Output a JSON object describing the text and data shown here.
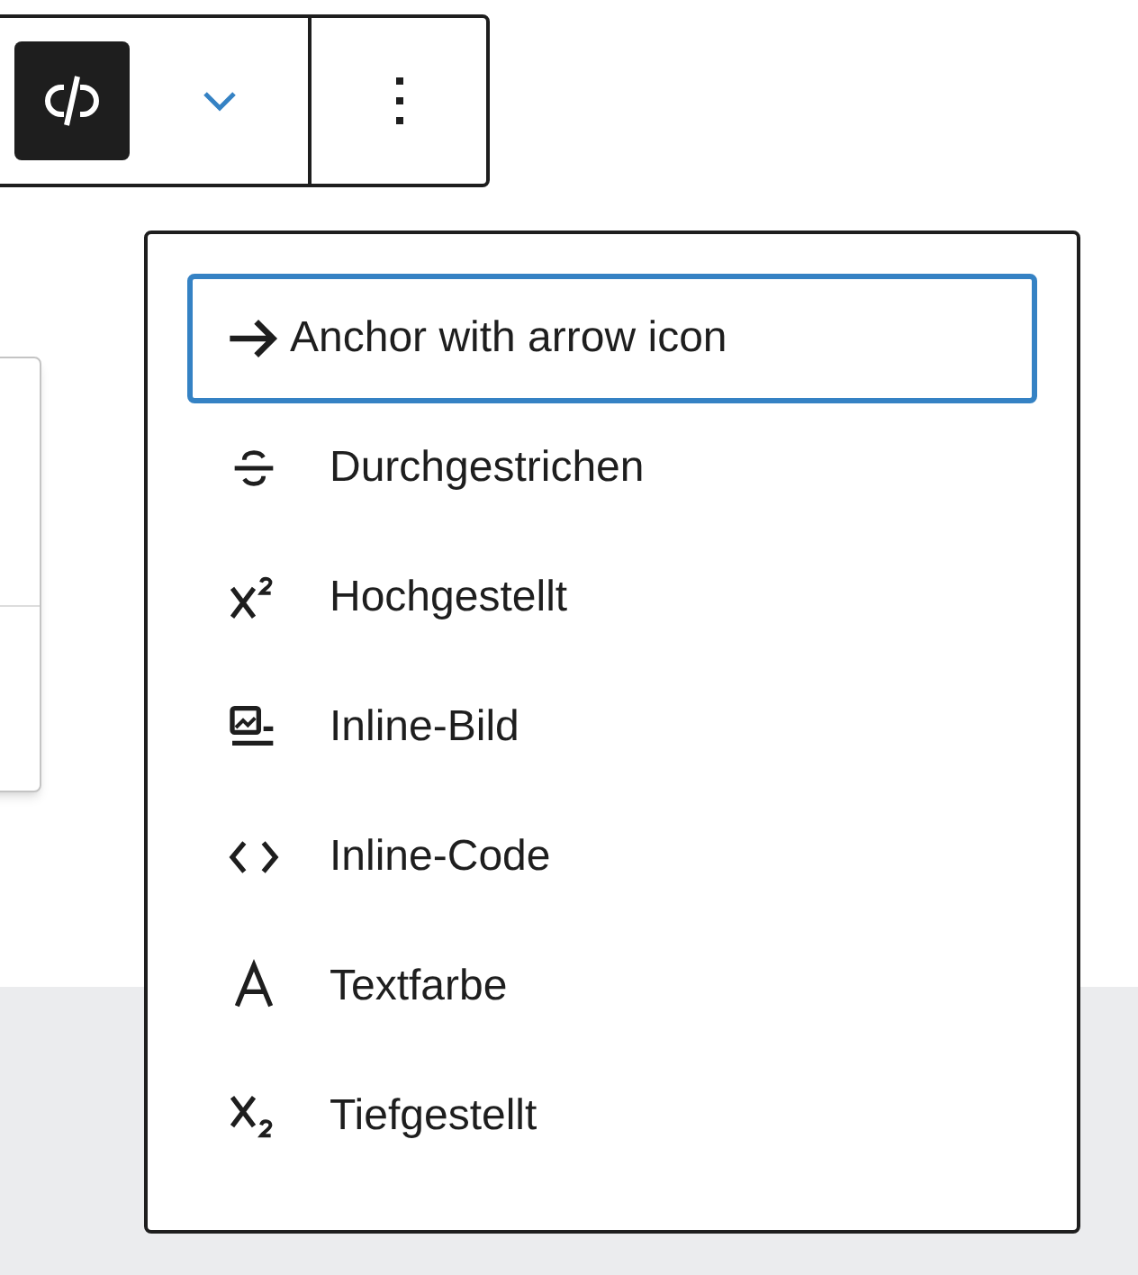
{
  "toolbar": {
    "unlink_pressed": true
  },
  "format_menu": {
    "items": [
      {
        "label": "Anchor with arrow icon",
        "selected": true
      },
      {
        "label": "Durchgestrichen",
        "selected": false
      },
      {
        "label": "Hochgestellt",
        "selected": false
      },
      {
        "label": "Inline-Bild",
        "selected": false
      },
      {
        "label": "Inline-Code",
        "selected": false
      },
      {
        "label": "Textfarbe",
        "selected": false
      },
      {
        "label": "Tiefgestellt",
        "selected": false
      }
    ]
  }
}
